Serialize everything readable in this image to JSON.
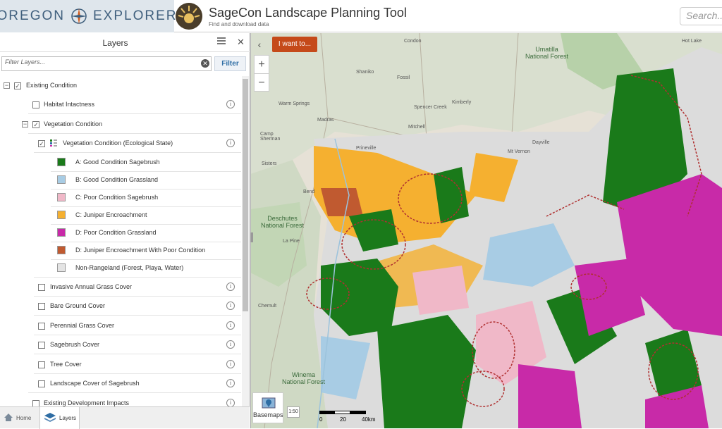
{
  "header": {
    "oe_left": "OREGON",
    "oe_right": "EXPLORER",
    "app_title": "SageCon Landscape Planning Tool",
    "app_subtitle": "Find and download data",
    "search_placeholder": "Search..."
  },
  "panel": {
    "title": "Layers",
    "filter_placeholder": "Filter Layers...",
    "filter_button": "Filter",
    "menu_icon": "hamburger-icon",
    "close_icon": "close-icon",
    "items": {
      "existing_condition": "Existing Condition",
      "habitat_intactness": "Habitat Intactness",
      "vegetation_condition": "Vegetation Condition",
      "veg_cond_eco": "Vegetation Condition (Ecological State)",
      "legend": [
        {
          "label": "A: Good Condition Sagebrush",
          "color": "#1a7a1a"
        },
        {
          "label": "B: Good Condition Grassland",
          "color": "#a8cce4"
        },
        {
          "label": "C: Poor Condition Sagebrush",
          "color": "#f0b8c8"
        },
        {
          "label": "C: Juniper Encroachment",
          "color": "#f5b030"
        },
        {
          "label": "D: Poor Condition Grassland",
          "color": "#c82aa8"
        },
        {
          "label": "D: Juniper Encroachment With Poor Condition",
          "color": "#c05a30"
        },
        {
          "label": "Non-Rangeland (Forest, Playa, Water)",
          "color": "#e4e4e4"
        }
      ],
      "invasive": "Invasive Annual Grass Cover",
      "bare_ground": "Bare Ground Cover",
      "perennial": "Perennial Grass Cover",
      "sagebrush": "Sagebrush Cover",
      "tree": "Tree Cover",
      "landscape_sage": "Landscape Cover of Sagebrush",
      "dev_impacts": "Existing Development Impacts"
    },
    "tabs": {
      "home": "Home",
      "layers": "Layers"
    }
  },
  "map": {
    "i_want_to": "I want to...",
    "zoom_in": "+",
    "zoom_out": "−",
    "basemaps": "Basemaps",
    "scale_btn": "1:50",
    "scale_0": "0",
    "scale_20": "20",
    "scale_40": "40km",
    "labels": {
      "umatilla": "Umatilla\nNational Forest",
      "deschutes": "Deschutes\nNational Forest",
      "winema": "Winema\nNational Forest",
      "bend": "Bend",
      "sisters": "Sisters",
      "madras": "Madras",
      "mitchell": "Mitchell",
      "la_pine": "La Pine",
      "chemult": "Chemult",
      "condon": "Condon",
      "hot_lake": "Hot Lake",
      "warm_springs": "Warm Springs",
      "kimberly": "Kimberly",
      "spencer_creek": "Spencer Creek",
      "day_dayville": "Dayville",
      "shaniko": "Shaniko",
      "fossil": "Fossil",
      "camp_sherman": "Camp\nSherman",
      "prineville": "Prineville",
      "mt_vernon": "Mt Vernon"
    }
  }
}
